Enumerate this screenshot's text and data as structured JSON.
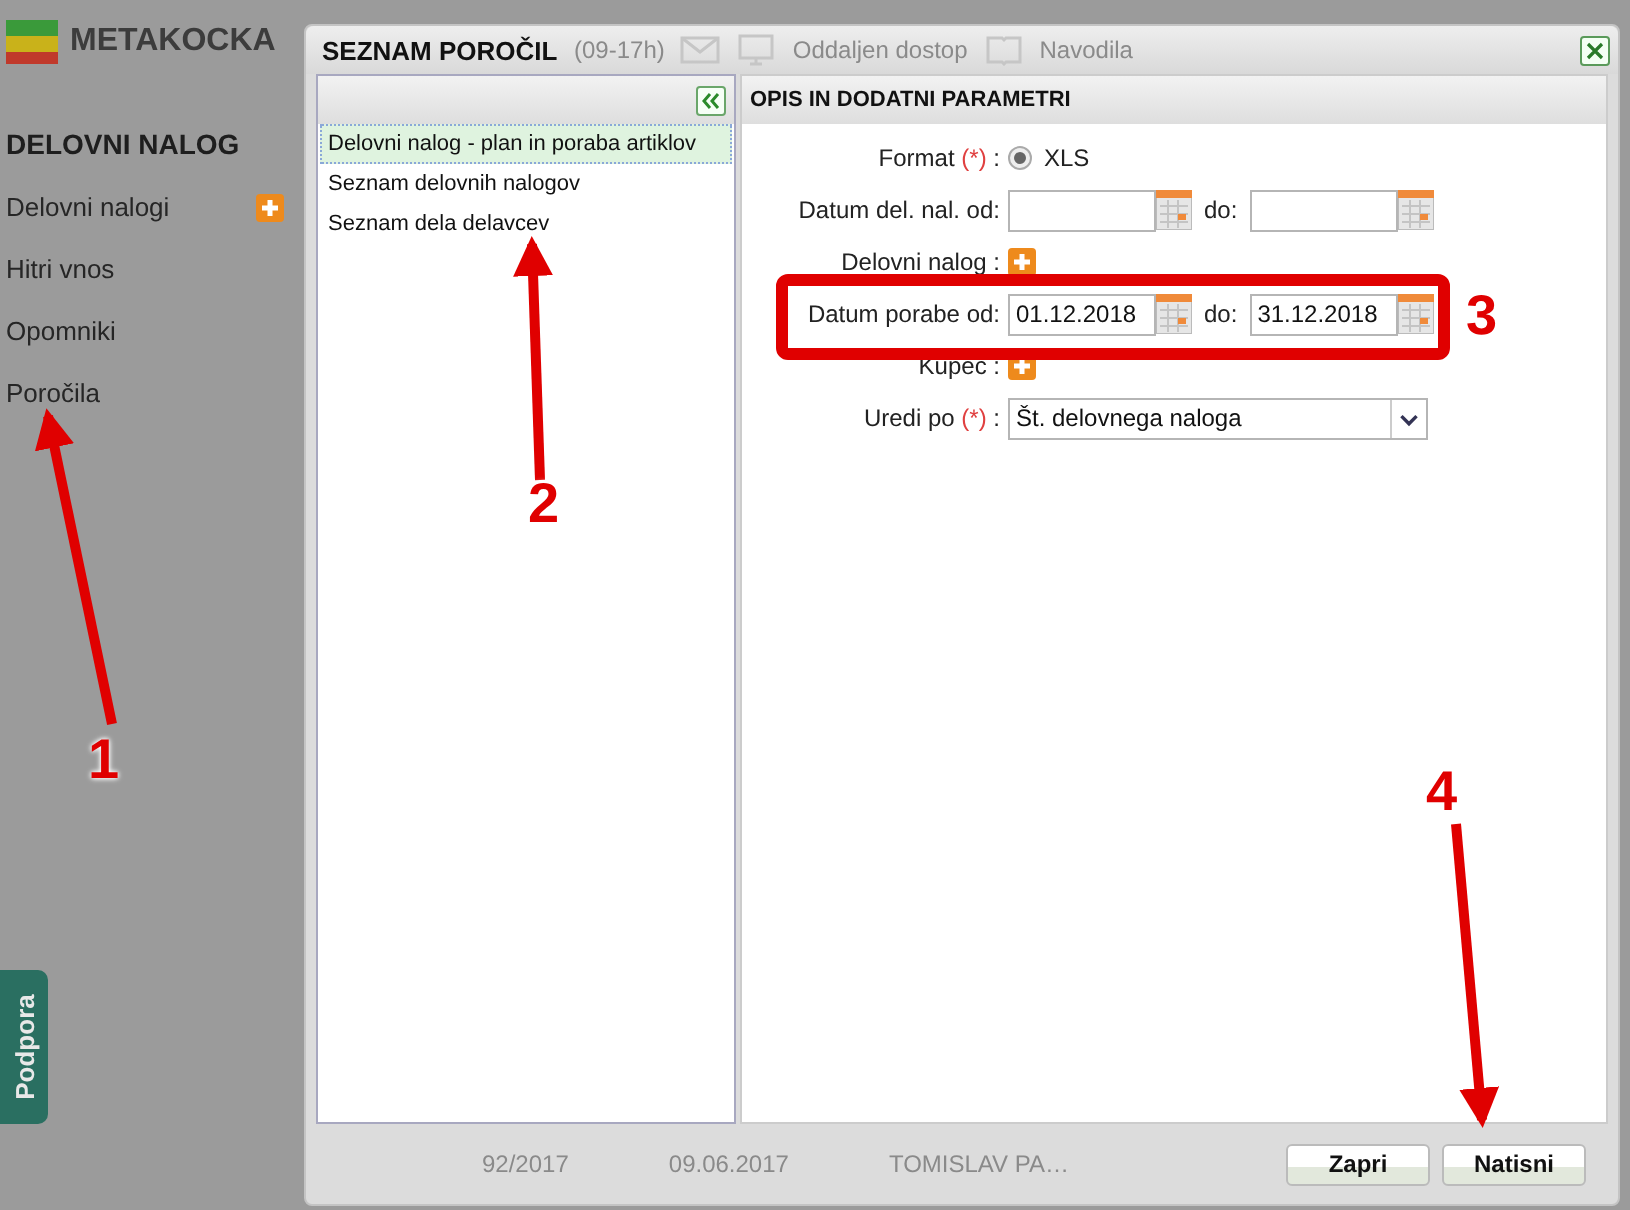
{
  "app": {
    "logo_text": "METAKOCKA"
  },
  "sidebar": {
    "heading": "DELOVNI NALOG",
    "items": [
      {
        "label": "Delovni nalogi",
        "has_add": true
      },
      {
        "label": "Hitri vnos",
        "has_add": false
      },
      {
        "label": "Opomniki",
        "has_add": false
      },
      {
        "label": "Poročila",
        "has_add": false
      }
    ]
  },
  "support_tab": "Podpora",
  "background_header": {
    "hours": "(09-17h)",
    "links": [
      {
        "kind": "monitor",
        "label": "Oddaljen dostop"
      },
      {
        "kind": "book",
        "label": "Navodila"
      }
    ]
  },
  "background_row": [
    "92/2017",
    "09.06.2017",
    "TOMISLAV PA…"
  ],
  "dialog": {
    "title": "SEZNAM POROČIL",
    "list": [
      {
        "label": "Delovni nalog - plan in poraba artiklov",
        "selected": true
      },
      {
        "label": "Seznam delovnih nalogov",
        "selected": false
      },
      {
        "label": "Seznam dela delavcev",
        "selected": false
      }
    ],
    "params_title": "OPIS IN DODATNI PARAMETRI",
    "fields": [
      {
        "kind": "radio",
        "label": "Format",
        "required_mark": "(*)",
        "colon": ":",
        "option": "XLS",
        "selected": true
      },
      {
        "kind": "daterange",
        "label": "Datum del. nal. od:",
        "to_label": "do:"
      },
      {
        "kind": "add",
        "label": "Delovni nalog :"
      },
      {
        "kind": "daterange",
        "label": "Datum porabe od:",
        "to_label": "do:",
        "from": "01.12.2018",
        "to": "31.12.2018"
      },
      {
        "kind": "add",
        "label": "Kupec :"
      },
      {
        "kind": "select",
        "label": "Uredi po",
        "required_mark": "(*)",
        "colon": ":",
        "value": "Št. delovnega naloga"
      }
    ],
    "buttons": [
      "Zapri",
      "Natisni"
    ]
  },
  "annotations": [
    {
      "kind": "arrow",
      "number": "1"
    },
    {
      "kind": "arrow",
      "number": "2"
    },
    {
      "kind": "frame",
      "number": "3"
    },
    {
      "kind": "arrow",
      "number": "4"
    }
  ]
}
